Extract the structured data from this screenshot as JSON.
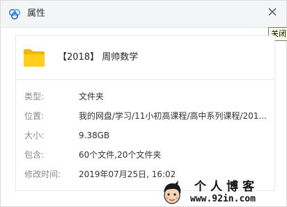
{
  "window": {
    "title": "属性",
    "close_tooltip": "关闭"
  },
  "file": {
    "name": "【2018】 周帅数学",
    "icon": "folder-icon"
  },
  "properties": [
    {
      "label": "类型:",
      "value": "文件夹"
    },
    {
      "label": "位置:",
      "value": "我的网盘/学习/11小初高课程/高中系列课程/201..."
    },
    {
      "label": "大小:",
      "value": "9.38GB"
    },
    {
      "label": "包含:",
      "value": "60个文件,20个文件夹"
    },
    {
      "label": "修改时间:",
      "value": "2019年07月25日, 16:02"
    }
  ],
  "watermark": {
    "text": "个人博客",
    "url": "www.92in.com"
  },
  "colors": {
    "folder": "#f7c600",
    "logo_blue": "#3a8ef0",
    "label": "#888888",
    "value": "#333333"
  }
}
